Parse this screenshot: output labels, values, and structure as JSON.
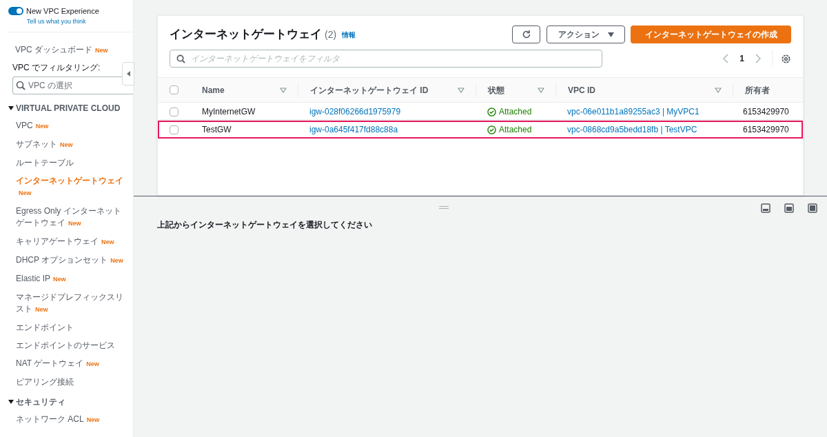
{
  "sidebar": {
    "toggle": {
      "label": "New VPC Experience",
      "on": true,
      "link": "Tell us what you think"
    },
    "dashboard": {
      "label": "VPC ダッシュボード",
      "badge": "New"
    },
    "filter_label": "VPC でフィルタリング:",
    "vpc_select": {
      "placeholder": "VPC の選択"
    },
    "sections": [
      {
        "title": "VIRTUAL PRIVATE CLOUD",
        "expanded": true,
        "items": [
          {
            "label": "VPC",
            "badge": "New",
            "selected": false
          },
          {
            "label": "サブネット",
            "badge": "New",
            "selected": false
          },
          {
            "label": "ルートテーブル",
            "selected": false
          },
          {
            "label": "インターネットゲートウェイ",
            "badge": "New",
            "selected": true
          },
          {
            "label": "Egress Only インターネットゲートウェイ",
            "badge": "New",
            "selected": false
          },
          {
            "label": "キャリアゲートウェイ",
            "badge": "New",
            "selected": false
          },
          {
            "label": "DHCP オプションセット",
            "badge": "New",
            "selected": false
          },
          {
            "label": "Elastic IP",
            "badge": "New",
            "selected": false
          },
          {
            "label": "マネージドプレフィックスリスト",
            "badge": "New",
            "selected": false
          },
          {
            "label": "エンドポイント",
            "selected": false
          },
          {
            "label": "エンドポイントのサービス",
            "selected": false
          },
          {
            "label": "NAT ゲートウェイ",
            "badge": "New",
            "selected": false
          },
          {
            "label": "ピアリング接続",
            "selected": false
          }
        ]
      },
      {
        "title": "セキュリティ",
        "expanded": true,
        "items": [
          {
            "label": "ネットワーク ACL",
            "badge": "New",
            "selected": false
          }
        ]
      }
    ]
  },
  "panel": {
    "title": "インターネットゲートウェイ",
    "count": "(2)",
    "info": "情報",
    "actions": "アクション",
    "create": "インターネットゲートウェイの作成",
    "filter": {
      "placeholder": "インターネットゲートウェイをフィルタ"
    },
    "page": "1",
    "all_checked": false,
    "columns": [
      {
        "label": "Name",
        "sortable": true
      },
      {
        "label": "インターネットゲートウェイ ID",
        "sortable": true
      },
      {
        "label": "状態",
        "sortable": true
      },
      {
        "label": "VPC ID",
        "sortable": true
      },
      {
        "label": "所有者",
        "sortable": false
      }
    ],
    "rows": [
      {
        "name": "MyInternetGW",
        "id": "igw-028f06266d1975979",
        "state": "Attached",
        "vpc": "vpc-06e011b1a89255ac3 | MyVPC1",
        "owner": "6153429970",
        "checked": false,
        "highlighted": false
      },
      {
        "name": "TestGW",
        "id": "igw-0a645f417fd88c88a",
        "state": "Attached",
        "vpc": "vpc-0868cd9a5bedd18fb | TestVPC",
        "owner": "6153429970",
        "checked": false,
        "highlighted": true
      }
    ]
  },
  "details": {
    "message": "上記からインターネットゲートウェイを選択してください"
  }
}
